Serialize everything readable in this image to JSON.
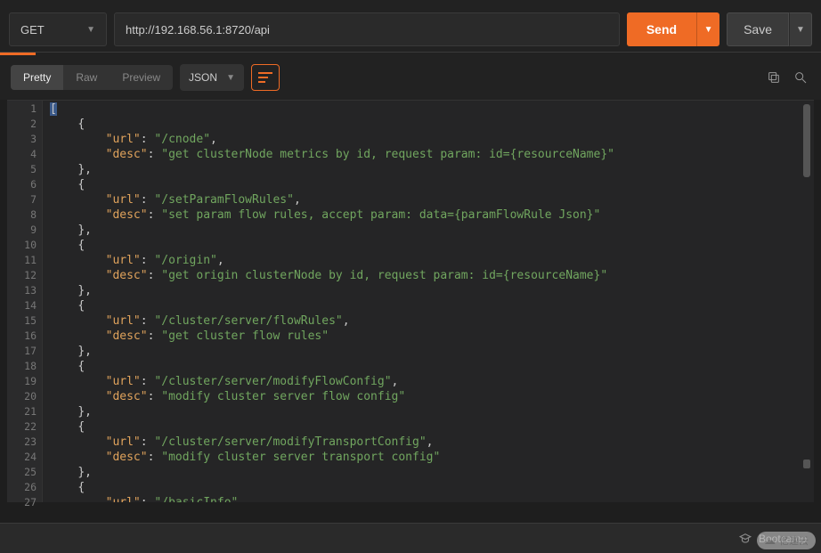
{
  "request": {
    "method": "GET",
    "url": "http://192.168.56.1:8720/api",
    "send_label": "Send",
    "save_label": "Save"
  },
  "toolbar": {
    "view_tabs": [
      "Pretty",
      "Raw",
      "Preview"
    ],
    "active_view": "Pretty",
    "format": "JSON"
  },
  "footer": {
    "bootcamp": "Bootcamp",
    "watermark": "亿速云"
  },
  "response_body": [
    {
      "url": "/cnode",
      "desc": "get clusterNode metrics by id, request param: id={resourceName}"
    },
    {
      "url": "/setParamFlowRules",
      "desc": "set param flow rules, accept param: data={paramFlowRule Json}"
    },
    {
      "url": "/origin",
      "desc": "get origin clusterNode by id, request param: id={resourceName}"
    },
    {
      "url": "/cluster/server/flowRules",
      "desc": "get cluster flow rules"
    },
    {
      "url": "/cluster/server/modifyFlowConfig",
      "desc": "modify cluster server flow config"
    },
    {
      "url": "/cluster/server/modifyTransportConfig",
      "desc": "modify cluster server transport config"
    },
    {
      "url": "/basicInfo"
    }
  ]
}
